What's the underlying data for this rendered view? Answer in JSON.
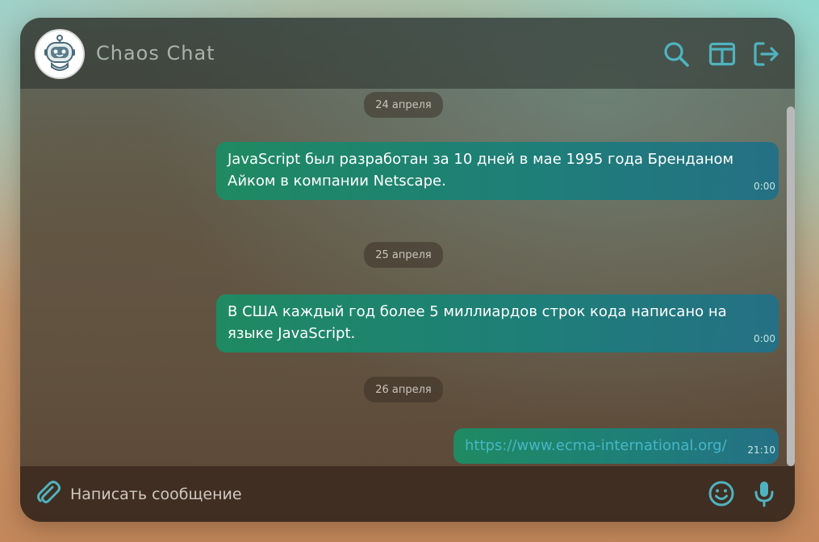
{
  "app": {
    "title": "Chaos Chat"
  },
  "header": {
    "icons": [
      "search-icon",
      "columns-icon",
      "logout-icon"
    ]
  },
  "messages": [
    {
      "date": "24 апреля",
      "text": "JavaScript был разработан за 10 дней в мае 1995 года Бренданом Айком в компании Netscape.",
      "time": "0:00"
    },
    {
      "date": "25 апреля",
      "text": "В США каждый год более 5 миллиардов строк кода написано на языке JavaScript.",
      "time": "0:00"
    },
    {
      "date": "26 апреля",
      "text": "https://www.ecma-international.org/",
      "time": "21:10"
    }
  ],
  "composer": {
    "placeholder": "Написать сообщение",
    "icons": [
      "paperclip-icon",
      "emoji-icon",
      "microphone-icon"
    ]
  },
  "colors": {
    "accent": "#4fb3bf",
    "bubble_start": "#1f8a62",
    "bubble_end": "#257085",
    "link": "#46b6c8"
  }
}
